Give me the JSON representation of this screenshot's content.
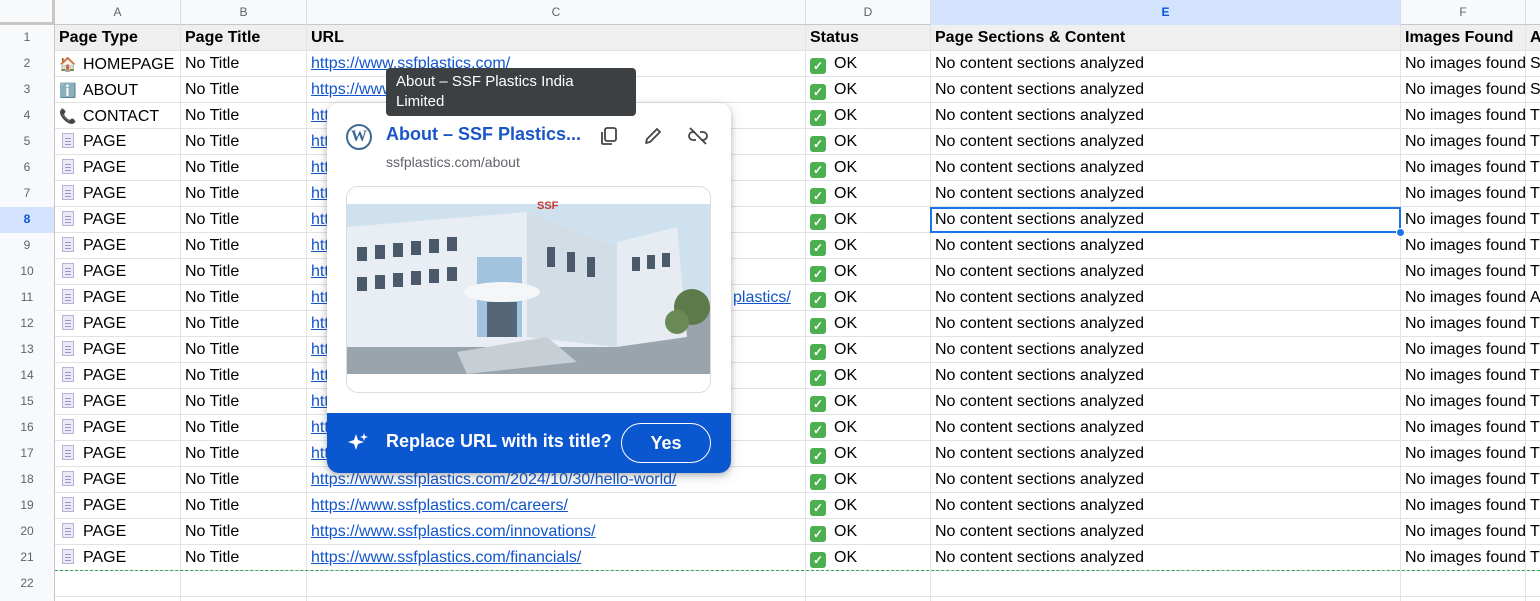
{
  "columns": [
    "A",
    "B",
    "C",
    "D",
    "E",
    "F"
  ],
  "rows": {
    "1": {
      "num": "1",
      "a": "Page Type",
      "b": "Page Title",
      "c": "URL",
      "d": "Status",
      "e": "Page Sections & Content",
      "f": "Images Found",
      "g": "A"
    },
    "2": {
      "num": "2",
      "icon": "🏠",
      "a": "HOMEPAGE",
      "b": "No Title",
      "c": "https://www.ssfplastics.com/",
      "d": "OK",
      "e": "No content sections analyzed",
      "f": "No images found",
      "g": "S"
    },
    "3": {
      "num": "3",
      "icon": "ℹ️",
      "a": "ABOUT",
      "b": "No Title",
      "c": "https://www.ssfplastics.com/about",
      "d": "OK",
      "e": "No content sections analyzed",
      "f": "No images found",
      "g": "S"
    },
    "4": {
      "num": "4",
      "icon": "📞",
      "a": "CONTACT",
      "b": "No Title",
      "c": "https://",
      "d": "OK",
      "e": "No content sections analyzed",
      "f": "No images found",
      "g": "T"
    },
    "5": {
      "num": "5",
      "a": "PAGE",
      "b": "No Title",
      "c": "https://",
      "d": "OK",
      "e": "No content sections analyzed",
      "f": "No images found",
      "g": "T"
    },
    "6": {
      "num": "6",
      "a": "PAGE",
      "b": "No Title",
      "c": "https://",
      "d": "OK",
      "e": "No content sections analyzed",
      "f": "No images found",
      "g": "T"
    },
    "7": {
      "num": "7",
      "a": "PAGE",
      "b": "No Title",
      "c": "https://",
      "d": "OK",
      "e": "No content sections analyzed",
      "f": "No images found",
      "g": "T"
    },
    "8": {
      "num": "8",
      "a": "PAGE",
      "b": "No Title",
      "c": "https://",
      "d": "OK",
      "e": "No content sections analyzed",
      "f": "No images found",
      "g": "T"
    },
    "9": {
      "num": "9",
      "a": "PAGE",
      "b": "No Title",
      "c": "https://",
      "d": "OK",
      "e": "No content sections analyzed",
      "f": "No images found",
      "g": "T"
    },
    "10": {
      "num": "10",
      "a": "PAGE",
      "b": "No Title",
      "c": "https://",
      "d": "OK",
      "e": "No content sections analyzed",
      "f": "No images found",
      "g": "T"
    },
    "11": {
      "num": "11",
      "a": "PAGE",
      "b": "No Title",
      "c": "https://",
      "c_tail": "plastics/",
      "d": "OK",
      "e": "No content sections analyzed",
      "f": "No images found",
      "g": "A"
    },
    "12": {
      "num": "12",
      "a": "PAGE",
      "b": "No Title",
      "c": "https://",
      "d": "OK",
      "e": "No content sections analyzed",
      "f": "No images found",
      "g": "T"
    },
    "13": {
      "num": "13",
      "a": "PAGE",
      "b": "No Title",
      "c": "https://",
      "d": "OK",
      "e": "No content sections analyzed",
      "f": "No images found",
      "g": "T"
    },
    "14": {
      "num": "14",
      "a": "PAGE",
      "b": "No Title",
      "c": "https://",
      "d": "OK",
      "e": "No content sections analyzed",
      "f": "No images found",
      "g": "T"
    },
    "15": {
      "num": "15",
      "a": "PAGE",
      "b": "No Title",
      "c": "https://",
      "d": "OK",
      "e": "No content sections analyzed",
      "f": "No images found",
      "g": "T"
    },
    "16": {
      "num": "16",
      "a": "PAGE",
      "b": "No Title",
      "c": "https://",
      "d": "OK",
      "e": "No content sections analyzed",
      "f": "No images found",
      "g": "T"
    },
    "17": {
      "num": "17",
      "a": "PAGE",
      "b": "No Title",
      "c": "https://",
      "d": "OK",
      "e": "No content sections analyzed",
      "f": "No images found",
      "g": "T"
    },
    "18": {
      "num": "18",
      "a": "PAGE",
      "b": "No Title",
      "c": "https://www.ssfplastics.com/2024/10/30/hello-world/",
      "d": "OK",
      "e": "No content sections analyzed",
      "f": "No images found",
      "g": "T"
    },
    "19": {
      "num": "19",
      "a": "PAGE",
      "b": "No Title",
      "c": "https://www.ssfplastics.com/careers/",
      "d": "OK",
      "e": "No content sections analyzed",
      "f": "No images found",
      "g": "T"
    },
    "20": {
      "num": "20",
      "a": "PAGE",
      "b": "No Title",
      "c": "https://www.ssfplastics.com/innovations/",
      "d": "OK",
      "e": "No content sections analyzed",
      "f": "No images found",
      "g": "T"
    },
    "21": {
      "num": "21",
      "a": "PAGE",
      "b": "No Title",
      "c": "https://www.ssfplastics.com/financials/",
      "d": "OK",
      "e": "No content sections analyzed",
      "f": "No images found",
      "g": "T"
    },
    "22": {
      "num": "22"
    },
    "23": {
      "num": ""
    }
  },
  "tooltip": {
    "text": "About – SSF Plastics India Limited"
  },
  "card": {
    "title": "About – SSF Plastics...",
    "domain": "ssfplastics.com/about",
    "icons": {
      "site": "wordpress-icon",
      "copy": "copy-icon",
      "edit": "pencil-icon",
      "unlink": "unlink-icon"
    },
    "preview_logo": "SSF",
    "prompt": "Replace URL with its title?",
    "yes_label": "Yes"
  },
  "colors": {
    "link": "#1155cc",
    "selection": "#1a73e8",
    "footer": "#0b57d0",
    "check": "#4caf50"
  }
}
